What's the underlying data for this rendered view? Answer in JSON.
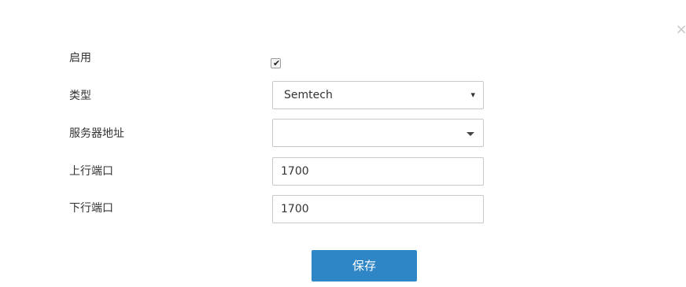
{
  "dialog": {
    "close_symbol": "×",
    "fields": {
      "enable": {
        "label": "启用",
        "checked": true,
        "check_symbol": "✔"
      },
      "type": {
        "label": "类型",
        "value": "Semtech",
        "arrow_symbol": "▾"
      },
      "server_address": {
        "label": "服务器地址",
        "value": ""
      },
      "uplink_port": {
        "label": "上行端口",
        "value": "1700"
      },
      "downlink_port": {
        "label": "下行端口",
        "value": "1700"
      }
    },
    "save_label": "保存"
  },
  "icons": [
    "close-icon",
    "checkbox-check-icon",
    "dropdown-arrow-icon",
    "caret-down-icon"
  ],
  "colors": {
    "primary": "#2f86c6",
    "border": "#c8c8c8",
    "text": "#333333"
  }
}
